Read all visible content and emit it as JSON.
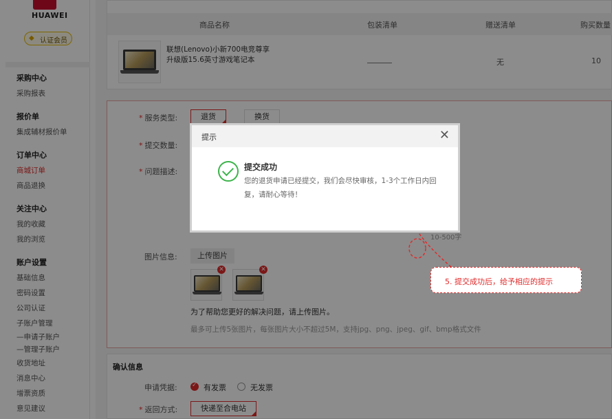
{
  "brand": {
    "logo_text": "HUAWEI",
    "member_badge": "认证会员"
  },
  "sidebar": {
    "groups": [
      {
        "title": "采购中心",
        "items": [
          "采购报表"
        ]
      },
      {
        "title": "报价单",
        "items": [
          "集成辅材报价单"
        ]
      },
      {
        "title": "订单中心",
        "items": [
          "商城订单",
          "商品退换"
        ]
      },
      {
        "title": "关注中心",
        "items": [
          "我的收藏",
          "我的浏览"
        ]
      },
      {
        "title": "账户设置",
        "items": [
          "基础信息",
          "密码设置",
          "公司认证",
          "子账户管理",
          "—申请子账户",
          "—管理子账户",
          "收货地址",
          "消息中心",
          "增票资质",
          "意见建议"
        ]
      }
    ],
    "active_item": "商城订单"
  },
  "product_table": {
    "headers": [
      "商品名称",
      "包装清单",
      "赠送清单",
      "购买数量"
    ],
    "row": {
      "name": "联想(Lenovo)小新700电竞尊享升级版15.6英寸游戏笔记本",
      "package": "———",
      "gift": "无",
      "qty": "10"
    }
  },
  "form": {
    "service_type_label": "服务类型:",
    "service_options": [
      "退货",
      "换货"
    ],
    "service_selected": "退货",
    "quantity_label": "提交数量:",
    "problem_label": "问题描述:",
    "char_limit": "10-500字",
    "image_label": "图片信息:",
    "upload_button": "上传图片",
    "upload_hint": "为了帮助您更好的解决问题，请上传图片。",
    "upload_rule": "最多可上传5张图片，每张图片大小不超过5M，支持jpg、png、jpeg、gif、bmp格式文件"
  },
  "confirm": {
    "title": "确认信息",
    "voucher_label": "申请凭据:",
    "voucher_options": [
      "有发票",
      "无发票"
    ],
    "voucher_selected": "有发票",
    "return_label": "返回方式:",
    "return_value": "快递至合电站"
  },
  "modal": {
    "title": "提示",
    "success_title": "提交成功",
    "success_message": "您的退货申请已经提交，我们会尽快审核，1-3个工作日内回复，请耐心等待！"
  },
  "annotation": {
    "text": "5. 提交成功后，给予相应的提示"
  },
  "colors": {
    "accent": "#e02a2a",
    "success": "#3cb34a"
  }
}
